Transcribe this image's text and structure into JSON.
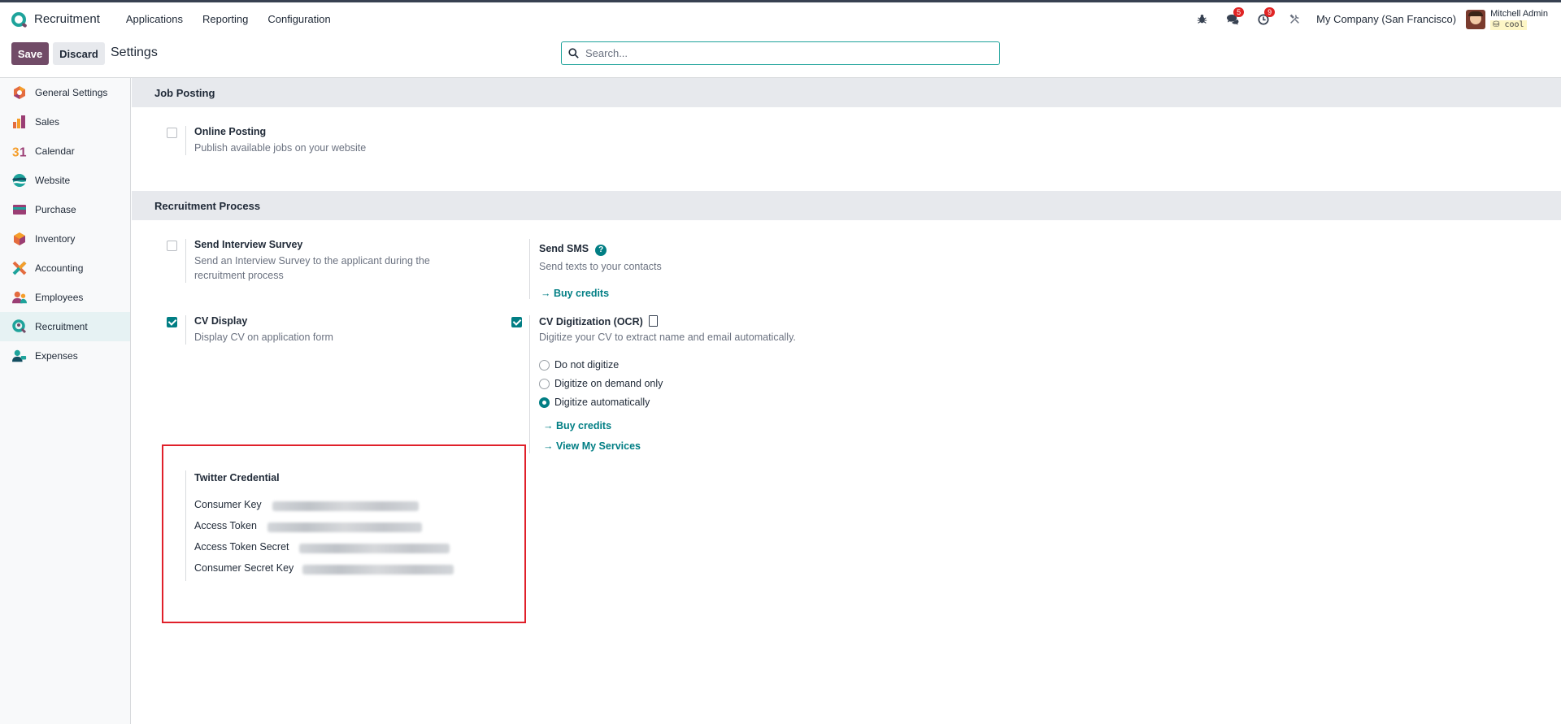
{
  "navbar": {
    "app_name": "Recruitment",
    "menu": [
      "Applications",
      "Reporting",
      "Configuration"
    ],
    "messages_count": "5",
    "activities_count": "9",
    "company": "My Company (San Francisco)",
    "user_name": "Mitchell Admin",
    "db_name": "cool"
  },
  "control": {
    "save_label": "Save",
    "discard_label": "Discard",
    "title": "Settings",
    "search_placeholder": "Search..."
  },
  "sidebar": {
    "items": [
      {
        "label": "General Settings",
        "icon": "general-settings-icon"
      },
      {
        "label": "Sales",
        "icon": "sales-icon"
      },
      {
        "label": "Calendar",
        "icon": "calendar-icon"
      },
      {
        "label": "Website",
        "icon": "website-icon"
      },
      {
        "label": "Purchase",
        "icon": "purchase-icon"
      },
      {
        "label": "Inventory",
        "icon": "inventory-icon"
      },
      {
        "label": "Accounting",
        "icon": "accounting-icon"
      },
      {
        "label": "Employees",
        "icon": "employees-icon"
      },
      {
        "label": "Recruitment",
        "icon": "recruitment-icon",
        "active": true
      },
      {
        "label": "Expenses",
        "icon": "expenses-icon"
      }
    ]
  },
  "job_posting": {
    "heading": "Job Posting",
    "online_posting": {
      "title": "Online Posting",
      "desc": "Publish available jobs on your website",
      "checked": false
    }
  },
  "recruitment_process": {
    "heading": "Recruitment Process",
    "interview_survey": {
      "title": "Send Interview Survey",
      "desc_line1": "Send an Interview Survey to the applicant during the",
      "desc_line2": "recruitment process",
      "checked": false
    },
    "send_sms": {
      "title": "Send SMS",
      "desc": "Send texts to your contacts",
      "link": "→ Buy credits"
    },
    "cv_display": {
      "title": "CV Display",
      "desc": "Display CV on application form",
      "checked": true
    },
    "cv_digitization": {
      "title": "CV Digitization (OCR)",
      "desc": "Digitize your CV to extract name and email automatically.",
      "checked": true,
      "options": [
        "Do not digitize",
        "Digitize on demand only",
        "Digitize automatically"
      ],
      "selected": "Digitize automatically",
      "link_buy": "→ Buy credits",
      "link_services": "→ View My Services"
    }
  },
  "twitter": {
    "title": "Twitter Credential",
    "fields": [
      "Consumer Key",
      "Access Token",
      "Access Token Secret",
      "Consumer Secret Key"
    ]
  },
  "colors": {
    "brand": "#714b67",
    "accent": "#017e84",
    "highlight": "#e0202a"
  }
}
